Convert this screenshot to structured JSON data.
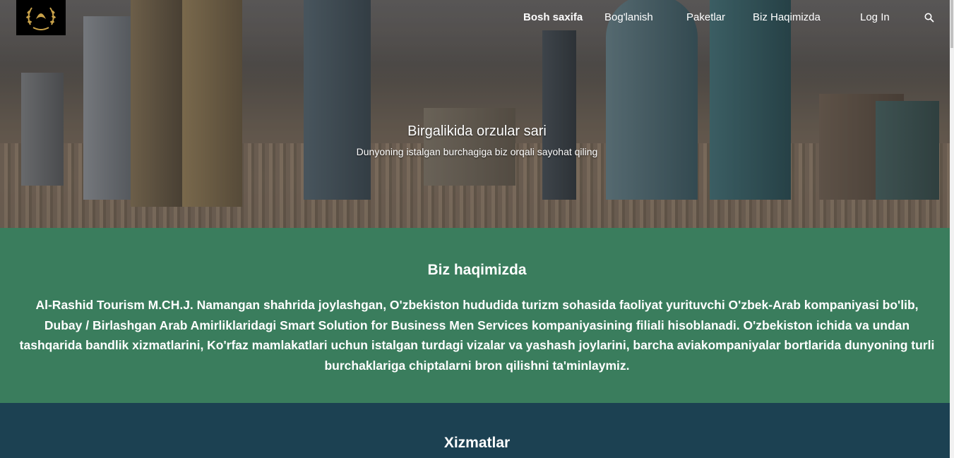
{
  "nav": {
    "items": [
      {
        "label": "Bosh saxifa",
        "active": true
      },
      {
        "label": "Bog'lanish",
        "active": false
      },
      {
        "label": "Paketlar",
        "active": false
      },
      {
        "label": "Biz Haqimizda",
        "active": false
      },
      {
        "label": "Log In",
        "active": false
      }
    ],
    "search_icon": "search-icon"
  },
  "logo": {
    "icon": "laurel-wreath-emblem",
    "color": "#c9a24a"
  },
  "hero": {
    "title": "Birgalikida orzular sari",
    "subtitle": "Dunyoning istalgan burchagiga biz orqali sayohat qiling"
  },
  "about": {
    "heading": "Biz haqimizda",
    "text": "Al-Rashid Tourism M.CH.J. Namangan shahrida joylashgan, O'zbekiston hududida turizm sohasida faoliyat yurituvchi O'zbek-Arab kompaniyasi bo'lib, Dubay / Birlashgan Arab Amirliklaridagi Smart Solution for Business Men Services kompaniyasining filiali hisoblanadi. O'zbekiston ichida va undan tashqarida bandlik xizmatlarini, Ko'rfaz mamlakatlari uchun istalgan turdagi vizalar va yashash joylarini, barcha aviakompaniyalar bortlarida dunyoning turli burchaklariga chiptalarni bron qilishni ta'minlaymiz.",
    "bg_color": "#3a7d5d"
  },
  "services": {
    "heading": "Xizmatlar",
    "bg_color": "#1c4152"
  }
}
